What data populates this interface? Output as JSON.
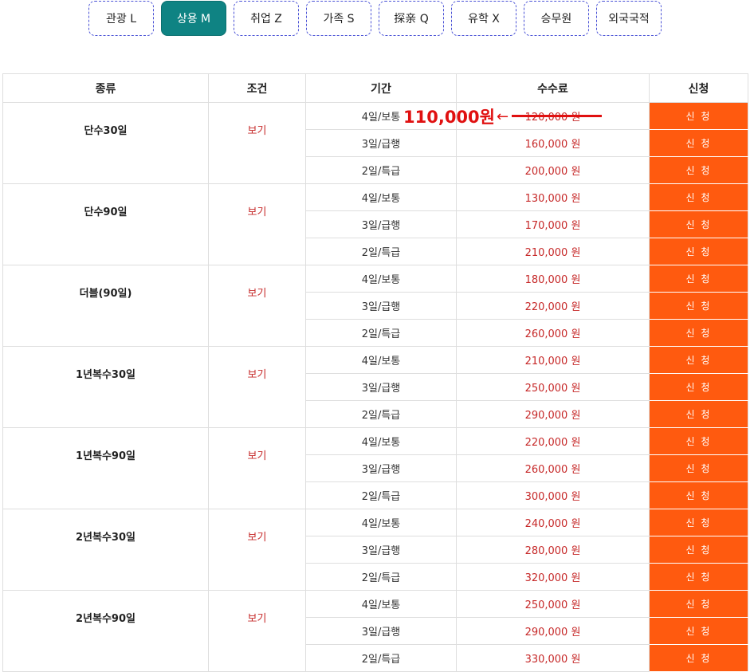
{
  "tabs": [
    {
      "label": "관광 L",
      "active": false
    },
    {
      "label": "상용 M",
      "active": true
    },
    {
      "label": "취업 Z",
      "active": false
    },
    {
      "label": "가족 S",
      "active": false
    },
    {
      "label": "探亲 Q",
      "active": false
    },
    {
      "label": "유학 X",
      "active": false
    },
    {
      "label": "승무원",
      "active": false
    },
    {
      "label": "외국국적",
      "active": false
    }
  ],
  "table": {
    "headers": {
      "kind": "종류",
      "condition": "조건",
      "period": "기간",
      "fee": "수수료",
      "apply": "신청"
    },
    "view_label": "보기",
    "apply_label": "신 청",
    "groups": [
      {
        "kind": "단수30일",
        "rows": [
          {
            "period": "4일/보통",
            "fee": "120,000 원"
          },
          {
            "period": "3일/급행",
            "fee": "160,000 원"
          },
          {
            "period": "2일/특급",
            "fee": "200,000 원"
          }
        ]
      },
      {
        "kind": "단수90일",
        "rows": [
          {
            "period": "4일/보통",
            "fee": "130,000 원"
          },
          {
            "period": "3일/급행",
            "fee": "170,000 원"
          },
          {
            "period": "2일/특급",
            "fee": "210,000 원"
          }
        ]
      },
      {
        "kind": "더블(90일)",
        "rows": [
          {
            "period": "4일/보통",
            "fee": "180,000 원"
          },
          {
            "period": "3일/급행",
            "fee": "220,000 원"
          },
          {
            "period": "2일/특급",
            "fee": "260,000 원"
          }
        ]
      },
      {
        "kind": "1년복수30일",
        "rows": [
          {
            "period": "4일/보통",
            "fee": "210,000 원"
          },
          {
            "period": "3일/급행",
            "fee": "250,000 원"
          },
          {
            "period": "2일/특급",
            "fee": "290,000 원"
          }
        ]
      },
      {
        "kind": "1년복수90일",
        "rows": [
          {
            "period": "4일/보통",
            "fee": "220,000 원"
          },
          {
            "period": "3일/급행",
            "fee": "260,000 원"
          },
          {
            "period": "2일/특급",
            "fee": "300,000 원"
          }
        ]
      },
      {
        "kind": "2년복수30일",
        "rows": [
          {
            "period": "4일/보통",
            "fee": "240,000 원"
          },
          {
            "period": "3일/급행",
            "fee": "280,000 원"
          },
          {
            "period": "2일/특급",
            "fee": "320,000 원"
          }
        ]
      },
      {
        "kind": "2년복수90일",
        "rows": [
          {
            "period": "4일/보통",
            "fee": "250,000 원"
          },
          {
            "period": "3일/급행",
            "fee": "290,000 원"
          },
          {
            "period": "2일/특급",
            "fee": "330,000 원"
          }
        ]
      }
    ]
  },
  "promo": {
    "price": "110,000원",
    "arrow": "←"
  },
  "colors": {
    "active_tab": "#0f8383",
    "tab_border": "#4a52d6",
    "apply_button": "#ff5a0f",
    "fee_text": "#c62828",
    "promo_text": "#e01010"
  }
}
